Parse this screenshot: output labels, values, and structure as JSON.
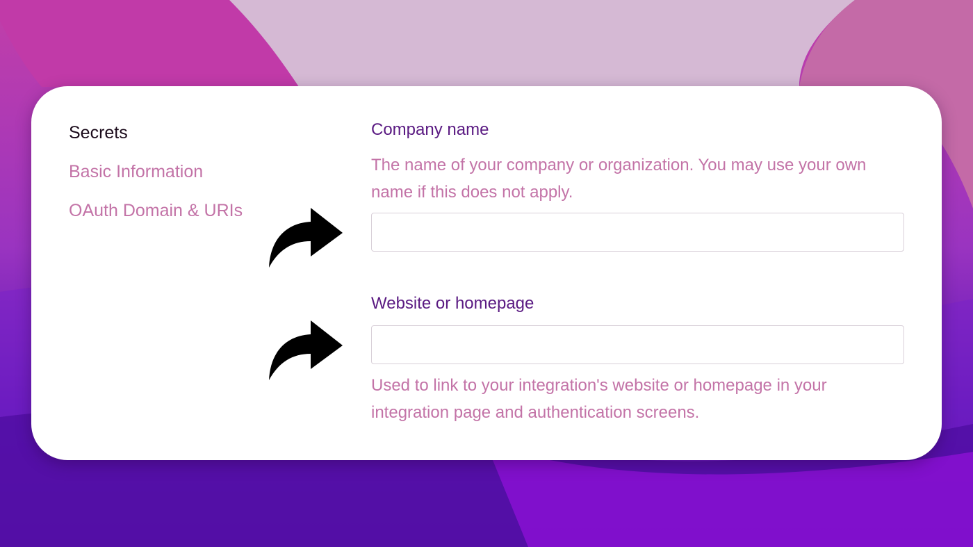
{
  "theme": {
    "accent_label": "#5a1a82",
    "muted_text": "#c373a7",
    "active_text": "#1a0a1a",
    "card_bg": "#ffffff"
  },
  "sidebar": {
    "items": [
      {
        "label": "Secrets",
        "active": true
      },
      {
        "label": "Basic Information",
        "active": false
      },
      {
        "label": "OAuth Domain & URIs",
        "active": false
      }
    ]
  },
  "form": {
    "company_name": {
      "label": "Company name",
      "help": "The name of your company or organization. You may use your own name if this does not apply.",
      "value": "",
      "placeholder": ""
    },
    "website": {
      "label": "Website or homepage",
      "help": "Used to link to your integration's website or homepage in your integration page and authentication screens.",
      "value": "",
      "placeholder": ""
    }
  },
  "annotations": {
    "arrow_icon": "curved-arrow-right-icon",
    "arrow_color": "#000000"
  }
}
